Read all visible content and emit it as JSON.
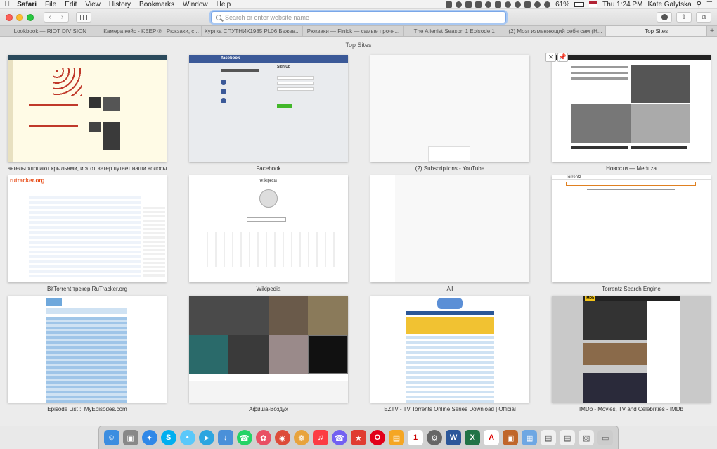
{
  "menubar": {
    "apple": "",
    "app": "Safari",
    "items": [
      "File",
      "Edit",
      "View",
      "History",
      "Bookmarks",
      "Window",
      "Help"
    ],
    "battery": "61%",
    "clock": "Thu 1:24 PM",
    "user": "Kate Galytska"
  },
  "toolbar": {
    "url_placeholder": "Search or enter website name"
  },
  "tabs": [
    {
      "label": "Lookbook — RIOT DIVISION",
      "active": false
    },
    {
      "label": "Камера кейс - KEEP ® | Рюкзаки, с...",
      "active": false
    },
    {
      "label": "Куртка СПУТНИК1985 PL06 Бежев...",
      "active": false
    },
    {
      "label": "Рюкзаки — Finick — самые прочн...",
      "active": false
    },
    {
      "label": "The Alienist Season 1 Episode 1",
      "active": false
    },
    {
      "label": "(2) Мозг изменяющий себя сам (Н...",
      "active": false
    },
    {
      "label": "Top Sites",
      "active": true
    }
  ],
  "content": {
    "title": "Top Sites",
    "sites": [
      {
        "label": "ангелы хлопают крыльями, и этот ветер путает наши волосы",
        "brand": ""
      },
      {
        "label": "Facebook",
        "brand": "facebook",
        "signup": "Sign Up"
      },
      {
        "label": "(2) Subscriptions - YouTube",
        "brand": ""
      },
      {
        "label": "Новости — Meduza",
        "brand": ""
      },
      {
        "label": "BitTorrent трекер RuTracker.org",
        "brand": "rutracker.org"
      },
      {
        "label": "Wikipedia",
        "brand": "Wikipedia"
      },
      {
        "label": "All",
        "brand": ""
      },
      {
        "label": "Torrentz Search Engine",
        "brand": "Torrentz"
      },
      {
        "label": "Episode List :: MyEpisodes.com",
        "brand": ""
      },
      {
        "label": "Афиша-Воздух",
        "brand": ""
      },
      {
        "label": "EZTV - TV Torrents Online Series Download | Official",
        "brand": ""
      },
      {
        "label": "IMDb - Movies, TV and Celebrities - IMDb",
        "brand": "IMDb"
      }
    ]
  },
  "colors": {
    "facebook": "#3b5998",
    "rutracker": "#e84f1b",
    "wiki_link": "#0645ad"
  }
}
